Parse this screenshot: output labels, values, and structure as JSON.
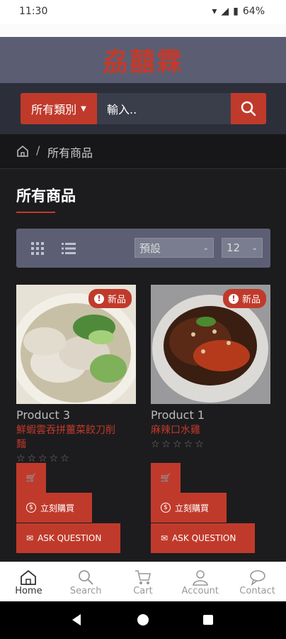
{
  "status": {
    "time": "11:30",
    "battery": "64%"
  },
  "brand": {
    "name": "劦囍霖"
  },
  "search": {
    "category_label": "所有類別",
    "placeholder": "輸入.."
  },
  "breadcrumb": {
    "separator": "/",
    "current": "所有商品"
  },
  "main": {
    "title": "所有商品"
  },
  "toolbar": {
    "sort_value": "預設",
    "per_page_value": "12"
  },
  "products": [
    {
      "badge": "新品",
      "name": "Product 3",
      "desc_line1": "鮮蝦雲吞拼薑菜餃刀削",
      "desc_line2": "麵",
      "rating": 0,
      "buy_label": "立刻購買",
      "ask_label": "ASK QUESTION"
    },
    {
      "badge": "新品",
      "name": "Product 1",
      "desc_line1": "麻辣口水雞",
      "desc_line2": "",
      "rating": 0,
      "buy_label": "立刻購買",
      "ask_label": "ASK QUESTION"
    }
  ],
  "bottom_nav": [
    {
      "label": "Home",
      "icon": "home-icon",
      "active": true
    },
    {
      "label": "Search",
      "icon": "search-icon",
      "active": false
    },
    {
      "label": "Cart",
      "icon": "cart-icon",
      "active": false
    },
    {
      "label": "Account",
      "icon": "account-icon",
      "active": false
    },
    {
      "label": "Contact",
      "icon": "chat-icon",
      "active": false
    }
  ],
  "colors": {
    "accent": "#c03a2b",
    "brandbar": "#5b5e73",
    "bg": "#1c1c1e"
  }
}
